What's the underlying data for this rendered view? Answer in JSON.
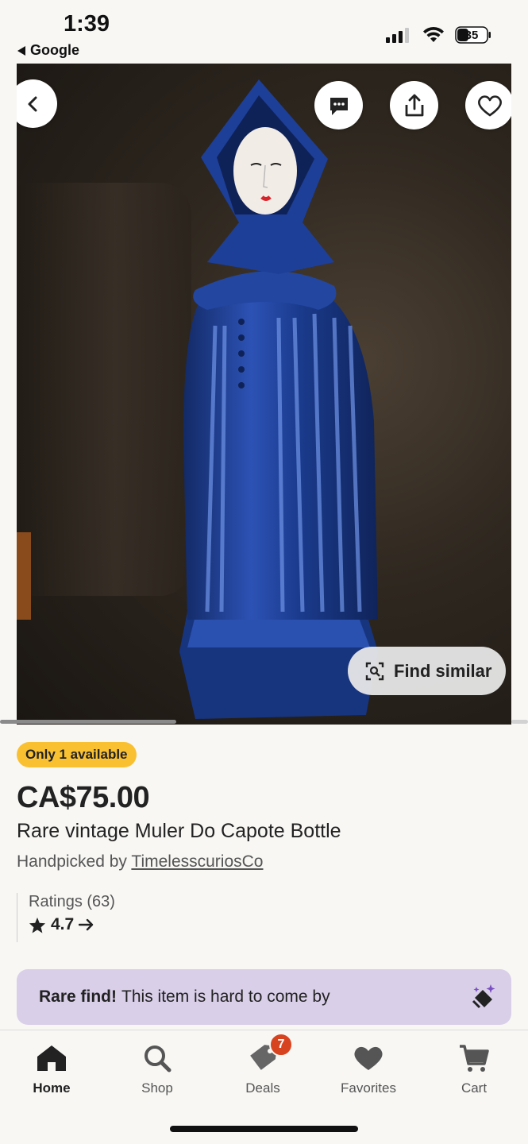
{
  "status": {
    "time": "1:39",
    "back_app": "Google",
    "battery": "35"
  },
  "hero": {
    "alt": "Blue ceramic hooded woman figurine bottle",
    "find_similar_label": "Find similar",
    "image_count_progress": 0.33
  },
  "listing": {
    "badge": "Only 1 available",
    "price": "CA$75.00",
    "title": "Rare vintage Muler Do Capote Bottle",
    "handpicked_prefix": "Handpicked by",
    "shop_name": "TimelesscuriosCo",
    "ratings_label": "Ratings (63)",
    "rating_value": "4.7"
  },
  "rare_banner": {
    "bold": "Rare find!",
    "text": "This item is hard to come by"
  },
  "tabs": [
    {
      "label": "Home",
      "icon": "home-icon",
      "active": true
    },
    {
      "label": "Shop",
      "icon": "search-icon"
    },
    {
      "label": "Deals",
      "icon": "tag-icon",
      "badge": "7"
    },
    {
      "label": "Favorites",
      "icon": "heart-icon"
    },
    {
      "label": "Cart",
      "icon": "cart-icon"
    }
  ],
  "colors": {
    "badge": "#f9c032",
    "rare_bg": "#d9cfe9",
    "deal_badge": "#d8431f",
    "figurine_blue": "#1f3f8f"
  }
}
